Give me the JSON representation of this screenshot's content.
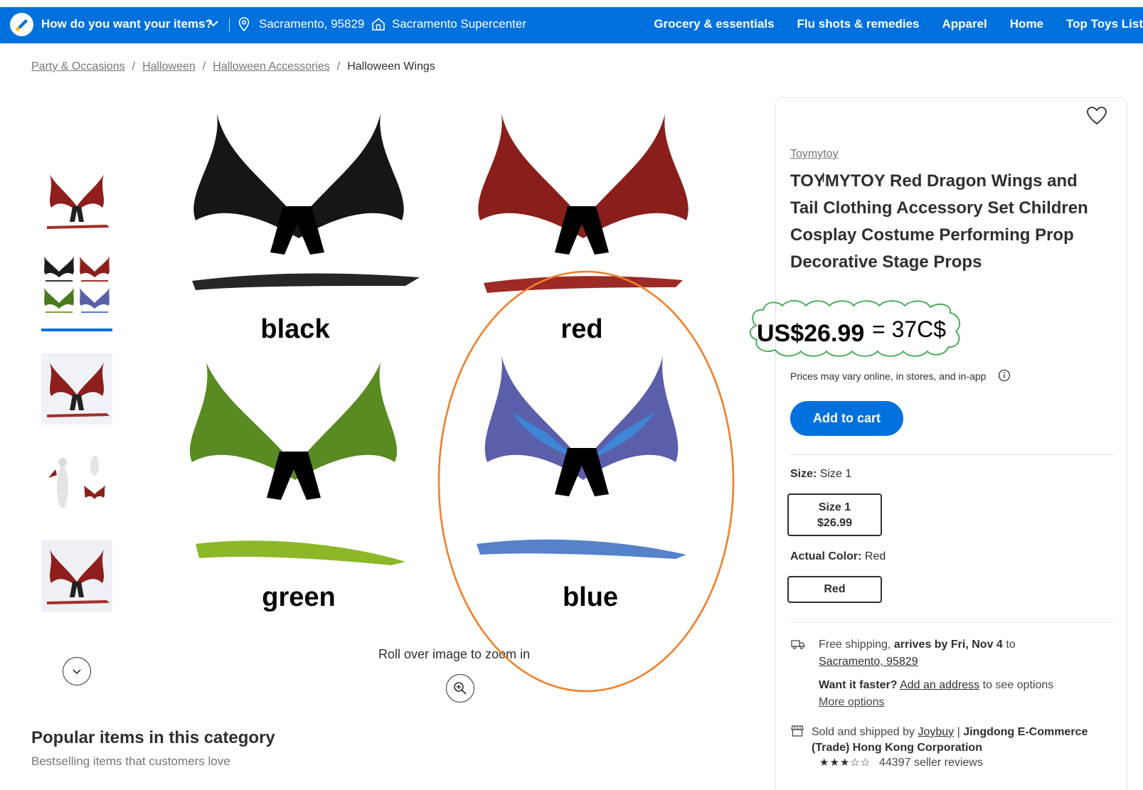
{
  "topbar": {
    "delivery_question": "How do you want your items?",
    "location": "Sacramento, 95829",
    "store": "Sacramento Supercenter",
    "links": [
      "Grocery & essentials",
      "Flu shots & remedies",
      "Apparel",
      "Home",
      "Top Toys List"
    ],
    "bg_color": "#0071dc"
  },
  "breadcrumb": {
    "items": [
      "Party & Occasions",
      "Halloween",
      "Halloween Accessories"
    ],
    "current": "Halloween Wings"
  },
  "gallery": {
    "labels": [
      "black",
      "red",
      "green",
      "blue"
    ],
    "zoom_hint": "Roll over image to zoom in",
    "active_thumb_index": 1
  },
  "popular": {
    "title": "Popular items in this category",
    "subtitle": "Bestselling items that customers love"
  },
  "product": {
    "brand": "Toymytoy",
    "title": "TOYMYTOY Red Dragon Wings and Tail Clothing Accessory Set Children Cosplay Costume Performing Prop Decorative Stage Props",
    "price": "US$26.99",
    "price_annotation": "= 37C$",
    "price_note": "Prices may vary online, in stores, and in-app",
    "add_to_cart": "Add to cart",
    "size_label": "Size:",
    "size_value": "Size 1",
    "size_option_name": "Size 1",
    "size_option_price": "$26.99",
    "color_label": "Actual Color:",
    "color_value": "Red",
    "color_option": "Red",
    "shipping_prefix": "Free shipping,",
    "shipping_bold": "arrives by Fri, Nov 4",
    "shipping_to": "to",
    "shipping_location": "Sacramento, 95829",
    "faster_bold": "Want it faster?",
    "faster_link": "Add an address",
    "faster_suffix": "to see options",
    "more_options": "More options",
    "sold_prefix": "Sold and shipped by",
    "sold_link": "Joybuy",
    "sold_sep": "|",
    "sold_bold": "Jingdong E-Commerce (Trade) Hong Kong Corporation",
    "seller_rating": 3,
    "seller_reviews": "44397 seller reviews",
    "annotation_colors": {
      "ellipse": "#f07f2a",
      "cloud": "#3aa84e"
    }
  }
}
